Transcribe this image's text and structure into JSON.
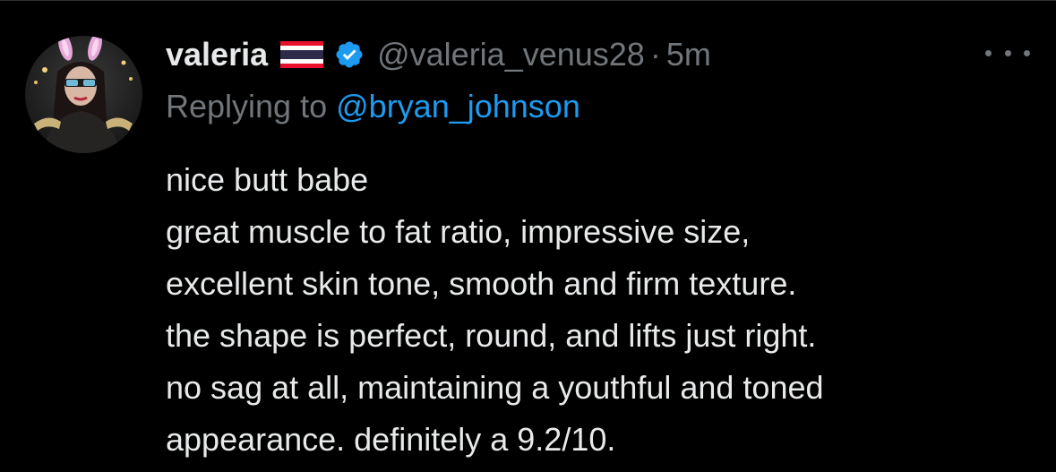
{
  "tweet": {
    "display_name": "valeria",
    "handle": "@valeria_venus28",
    "separator": "·",
    "time": "5m",
    "replying_prefix": "Replying to",
    "replying_handle": "@bryan_johnson",
    "text_lines": [
      "nice butt babe",
      "great muscle to fat ratio, impressive size,",
      "excellent skin tone, smooth and firm texture.",
      "the shape is perfect, round, and lifts just right.",
      "no sag at all, maintaining a youthful and toned",
      "appearance. definitely a 9.2/10."
    ]
  },
  "icons": {
    "flag": "thailand-flag-icon",
    "verified": "verified-badge-icon",
    "more": "more-options-icon"
  },
  "colors": {
    "background": "#000000",
    "primary_text": "#e7e9ea",
    "secondary_text": "#71767b",
    "accent": "#1d9bf0"
  }
}
